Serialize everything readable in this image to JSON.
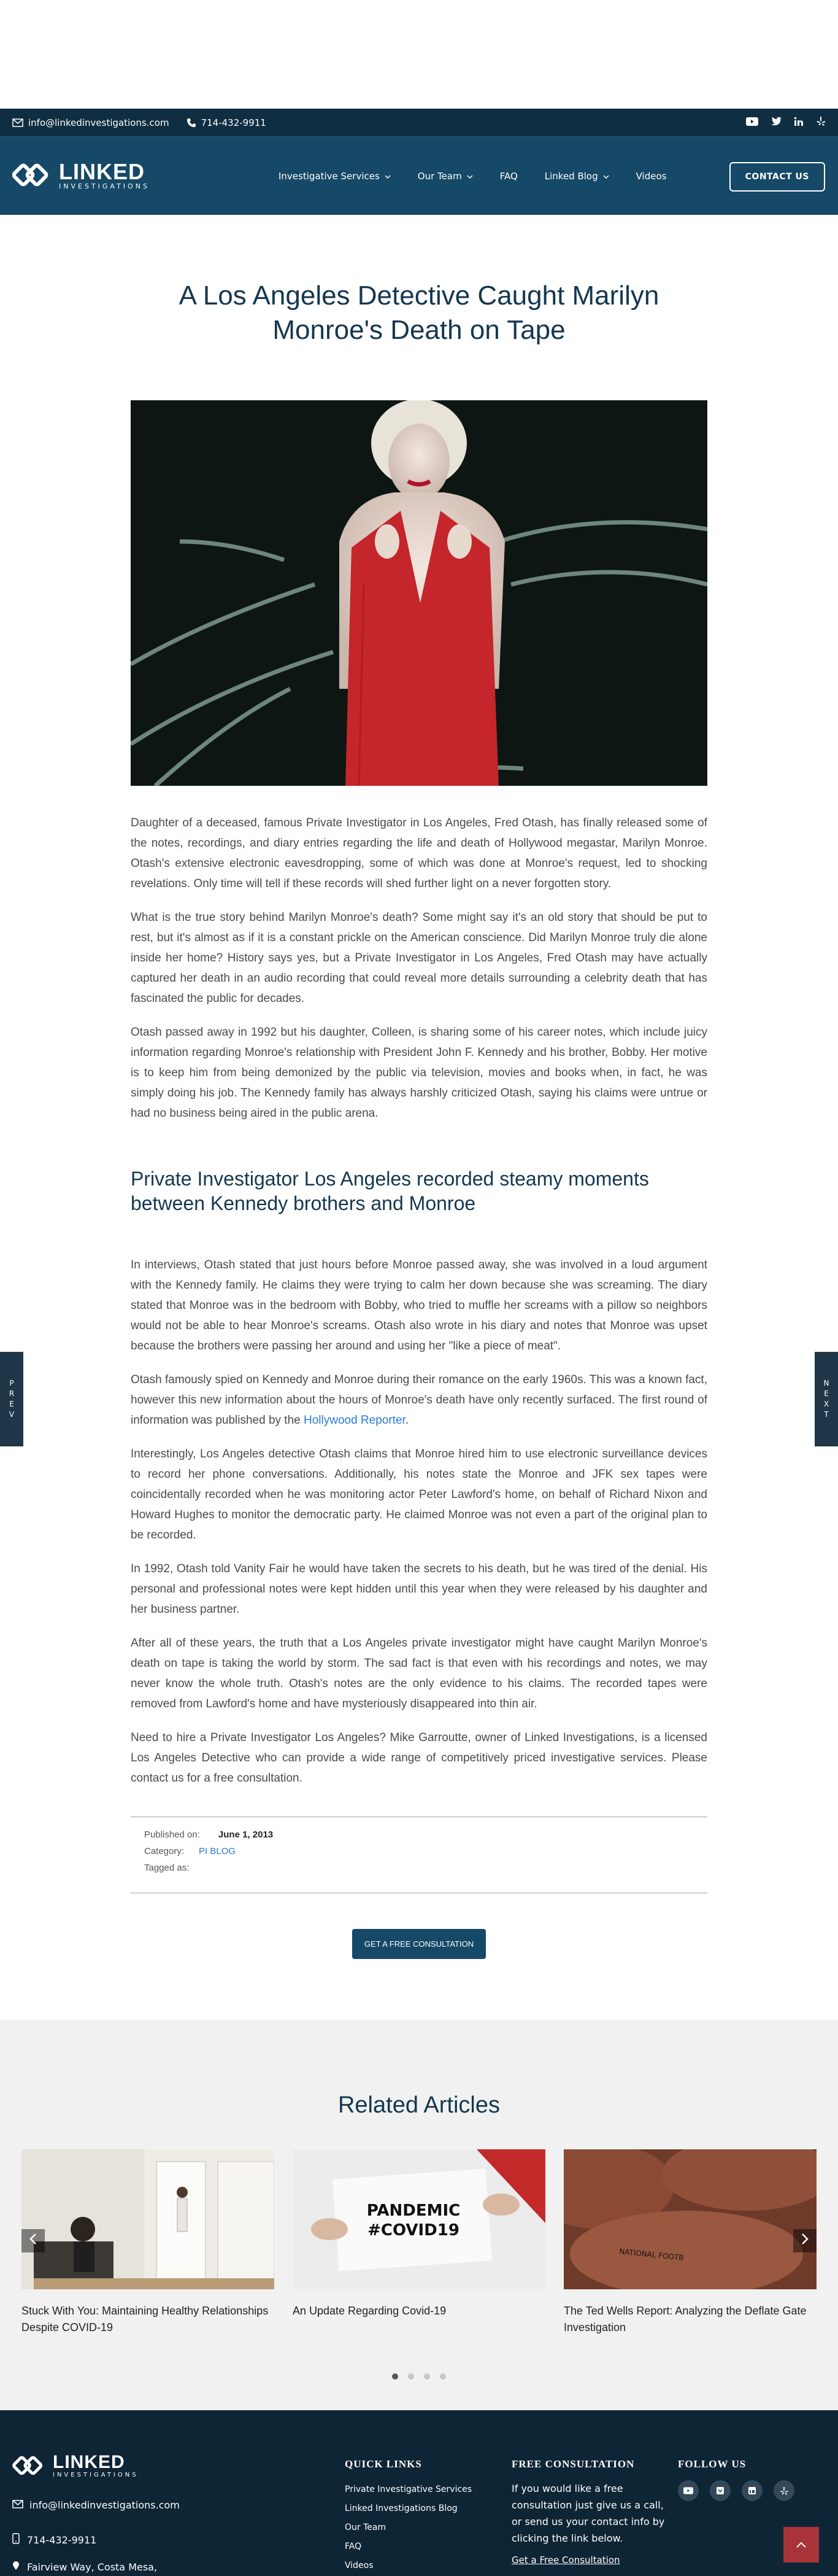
{
  "topbar": {
    "email": "info@linkedinvestigations.com",
    "phone": "714-432-9911",
    "social_icons": [
      "youtube-icon",
      "twitter-icon",
      "linkedin-icon",
      "yelp-icon"
    ]
  },
  "header": {
    "logo_name": "LINKED",
    "logo_sub": "INVESTIGATIONS",
    "nav": [
      {
        "label": "Investigative Services",
        "dropdown": true
      },
      {
        "label": "Our Team",
        "dropdown": true
      },
      {
        "label": "FAQ",
        "dropdown": false
      },
      {
        "label": "Linked Blog",
        "dropdown": true
      },
      {
        "label": "Videos",
        "dropdown": false
      }
    ],
    "contact_label": "CONTACT US"
  },
  "article": {
    "title": "A Los Angeles Detective Caught Marilyn Monroe's Death on Tape",
    "p1": "Daughter of a deceased, famous Private Investigator in Los Angeles, Fred Otash, has finally released some of the notes, recordings, and diary entries regarding the life and death of Hollywood megastar, Marilyn Monroe. Otash's extensive electronic eavesdropping, some of which was done at Monroe's request, led to shocking revelations. Only time will tell if these records will shed further light on a never forgotten story.",
    "p2": "What is the true story behind Marilyn Monroe's death? Some might say it's an old story that should be put to rest, but it's almost as if it is a constant prickle on the American conscience. Did Marilyn Monroe truly die alone inside her home? History says yes, but a Private Investigator in Los Angeles, Fred Otash may have actually captured her death in an audio recording that could reveal more details surrounding a celebrity death that has fascinated the public for decades.",
    "p3": "Otash passed away in 1992 but his daughter, Colleen, is sharing some of his career notes, which include juicy information regarding Monroe's relationship with President John F. Kennedy and his brother, Bobby. Her motive is to keep him from being demonized by the public via television, movies and books when, in fact, he was simply doing his job. The Kennedy family has always harshly criticized Otash, saying his claims were untrue or had no business being aired in the public arena.",
    "h2": "Private Investigator Los Angeles recorded steamy moments between Kennedy brothers and Monroe",
    "p4": "In interviews, Otash stated that just hours before Monroe passed away, she was involved in a loud argument with the Kennedy family. He claims they were trying to calm her down because she was screaming. The diary stated that Monroe was in the bedroom with Bobby, who tried to muffle her screams with a pillow so neighbors would not be able to hear Monroe's screams. Otash also wrote in his diary and notes that Monroe was upset because the brothers were passing her around and using her \"like a piece of meat\".",
    "p5_start": "Otash famously spied on Kennedy and Monroe during their romance on the early 1960s. This was a known fact, however this new information about the hours of Monroe's death have only recently surfaced. The first round of information was published by the ",
    "p5_link": "Hollywood Reporter",
    "p5_end": ".",
    "p6": "Interestingly, Los Angeles detective Otash claims that Monroe hired him to use electronic surveillance devices to record her phone conversations. Additionally, his notes state the Monroe and JFK sex tapes were coincidentally recorded when he was monitoring actor Peter Lawford's home, on behalf of Richard Nixon and Howard Hughes to monitor the democratic party. He claimed Monroe was not even a part of the original plan to be recorded.",
    "p7": "In 1992, Otash told Vanity Fair he would have taken the secrets to his death, but he was tired of the denial. His personal and professional notes were kept hidden until this year when they were released by his daughter and her business partner.",
    "p8": "After all of these years, the truth that a Los Angeles private investigator might have caught Marilyn Monroe's death on tape is taking the world by storm. The sad fact is that even with his recordings and notes, we may never know the whole truth. Otash's notes are the only evidence to his claims. The recorded tapes were removed from Lawford's home and have mysteriously disappeared into thin air.",
    "p9": "Need to hire a Private Investigator Los Angeles? Mike Garroutte, owner of Linked Investigations, is a licensed Los Angeles Detective who can provide a wide range of competitively priced investigative services. Please contact us for a free consultation.",
    "published_label": "Published on:",
    "published_date": "June 1, 2013",
    "category_label": "Category:",
    "category": "PI BLOG",
    "tagged_label": "Tagged as:",
    "cta": "GET A FREE CONSULTATION"
  },
  "side_tabs": {
    "prev": [
      "P",
      "R",
      "E",
      "V"
    ],
    "next": [
      "N",
      "E",
      "X",
      "T"
    ]
  },
  "related": {
    "heading": "Related Articles",
    "cards": [
      {
        "title": "Stuck With You: Maintaining Healthy Relationships Despite COVID-19"
      },
      {
        "title": "An Update Regarding Covid-19",
        "sign_line1": "PANDEMIC",
        "sign_line2": "#COVID19"
      },
      {
        "title": "The Ted Wells Report: Analyzing the Deflate Gate Investigation",
        "ball_text": "NATIONAL FOOTB"
      }
    ],
    "active_dot": 0,
    "dot_count": 4
  },
  "footer": {
    "email": "info@linkedinvestigations.com",
    "phone": "714-432-9911",
    "address": "Fairview Way, Costa Mesa,",
    "quick_links_heading": "QUICK LINKS",
    "quick_links": [
      "Private Investigative Services",
      "Linked Investigations Blog",
      "Our Team",
      "FAQ",
      "Videos"
    ],
    "consult_heading": "FREE CONSULTATION",
    "consult_text": "If you would like a free consultation just give us a call, or send us your contact info by clicking the link below.",
    "consult_link": "Get a Free Consultation",
    "follow_heading": "FOLLOW US"
  },
  "colors": {
    "navy": "#164967",
    "topbar": "#0f2e42",
    "footer": "#0e2536",
    "accent_red": "#a8343a",
    "link": "#2a7bd5"
  }
}
